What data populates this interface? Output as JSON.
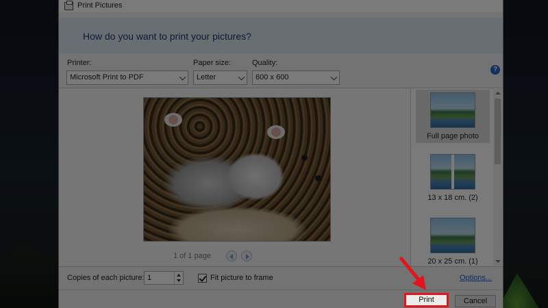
{
  "window": {
    "title": "Print Pictures"
  },
  "banner": {
    "heading": "How do you want to print your pictures?"
  },
  "printer": {
    "label": "Printer:",
    "value": "Microsoft Print to PDF"
  },
  "paper_size": {
    "label": "Paper size:",
    "value": "Letter"
  },
  "quality": {
    "label": "Quality:",
    "value": "600 x 600"
  },
  "help": {
    "icon": "help-icon",
    "glyph": "?"
  },
  "preview": {
    "page_info": "1 of 1 page"
  },
  "layouts": [
    {
      "label": "Full page photo",
      "selected": true
    },
    {
      "label": "13 x 18 cm. (2)",
      "selected": false
    },
    {
      "label": "20 x 25 cm. (1)",
      "selected": false
    }
  ],
  "copies": {
    "label": "Copies of each picture:",
    "value": "1"
  },
  "fit": {
    "label": "Fit picture to frame",
    "checked": true
  },
  "options_link": "Options...",
  "buttons": {
    "print": "Print",
    "cancel": "Cancel"
  },
  "colors": {
    "highlight": "#e3141b",
    "banner_text": "#1e3a6e",
    "link": "#1a5bd6"
  }
}
